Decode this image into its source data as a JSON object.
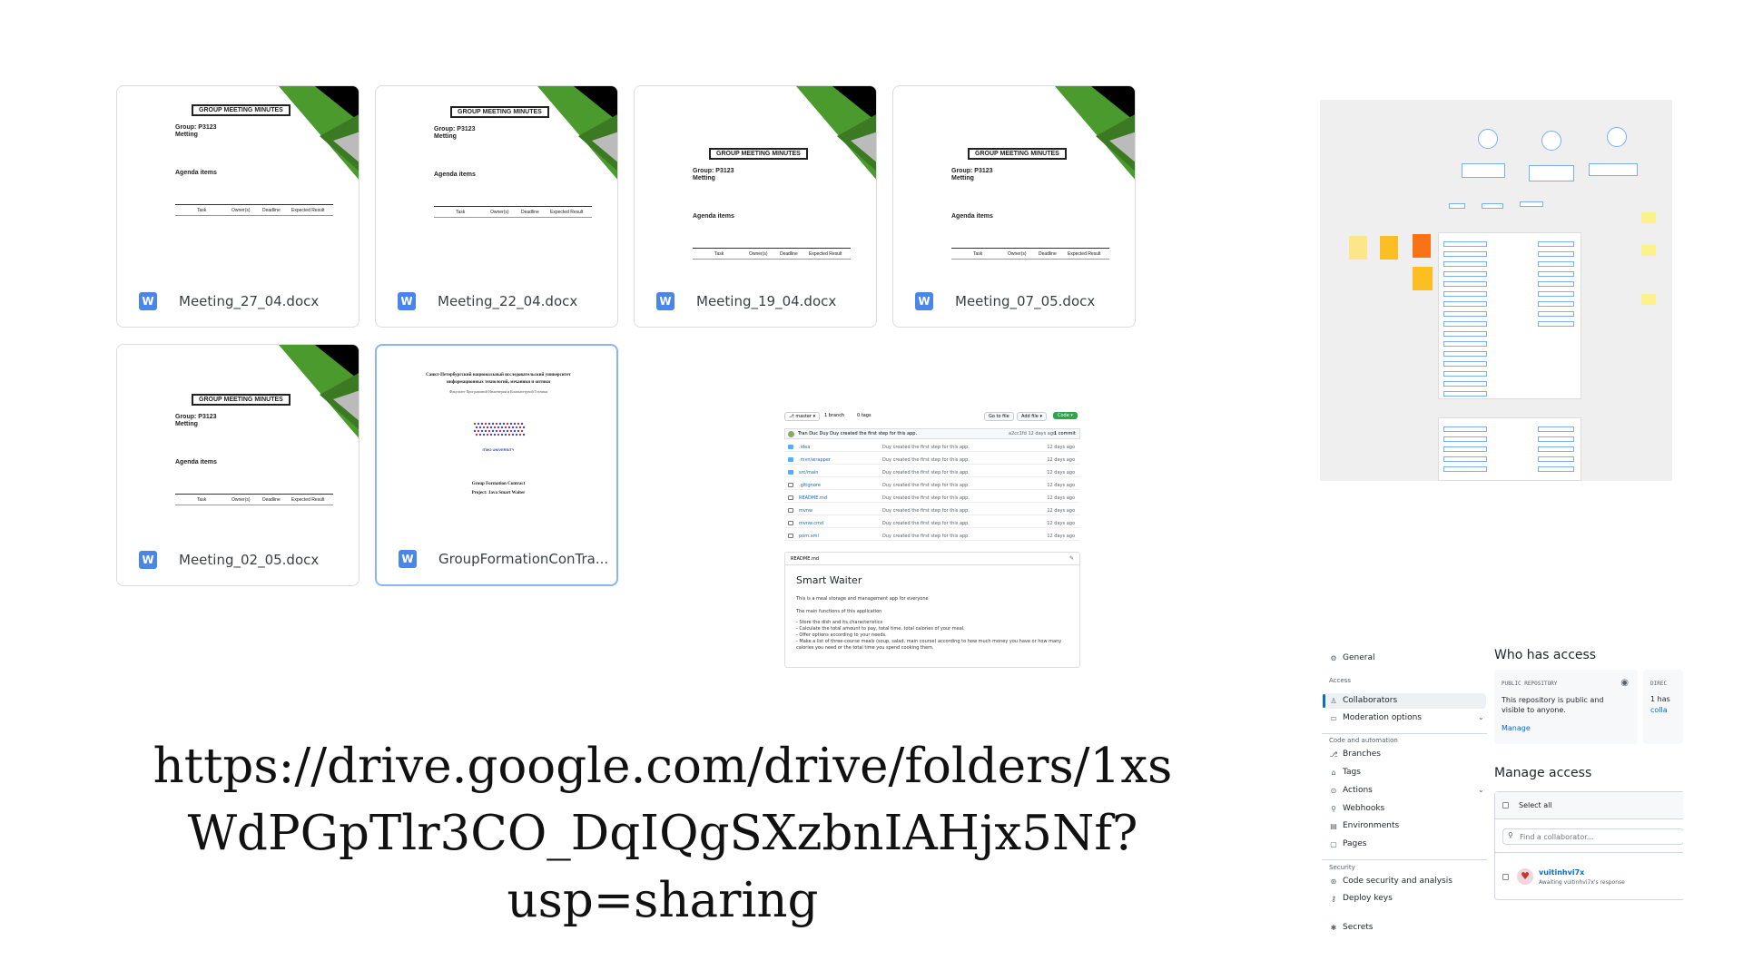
{
  "files": [
    {
      "name": "Meeting_27_04.docx",
      "icon": "W"
    },
    {
      "name": "Meeting_22_04.docx",
      "icon": "W"
    },
    {
      "name": "Meeting_19_04.docx",
      "icon": "W"
    },
    {
      "name": "Meeting_07_05.docx",
      "icon": "W"
    },
    {
      "name": "Meeting_02_05.docx",
      "icon": "W"
    },
    {
      "name": "GroupFormationConTra...",
      "icon": "W"
    }
  ],
  "doc_preview": {
    "title": "GROUP MEETING MINUTES",
    "group": "Group: P3123",
    "metting": "Metting",
    "agenda": "Agenda items",
    "col_task": "Task",
    "col_owner": "Owner(s)",
    "col_deadline": "Deadline",
    "col_result": "Expected Result"
  },
  "contract_preview": {
    "line1": "Санкт-Петербургский национальный исследовательский университет",
    "line2": "информационных технологий, механики и оптики",
    "line3": "Факультет Программной Инженерии и Компьютерной Техники",
    "logo": "ITMO UNIVERSITY",
    "line4": "Group Formation Contract",
    "line5": "Project: Java Smart Waiter"
  },
  "repo": {
    "branch": "master",
    "branches": "1 branch",
    "tags": "0 tags",
    "goto_file": "Go to file",
    "add_file": "Add file",
    "code": "Code",
    "commit_msg": "Tran Duc Duy Duy created the first step for this app.",
    "commit_meta": "a2cc1fd  12 days ago",
    "commits": "1 commit",
    "files": [
      {
        "name": ".idea",
        "dir": true
      },
      {
        "name": ".mvn/wrapper",
        "dir": true
      },
      {
        "name": "src/main",
        "dir": true
      },
      {
        "name": ".gitignore",
        "dir": false
      },
      {
        "name": "README.md",
        "dir": false
      },
      {
        "name": "mvnw",
        "dir": false
      },
      {
        "name": "mvnw.cmd",
        "dir": false
      },
      {
        "name": "pom.xml",
        "dir": false
      }
    ],
    "file_msg": "Duy created the first step for this app.",
    "file_age": "12 days ago",
    "readme_label": "README.md",
    "readme_title": "Smart Waiter",
    "readme_intro": "This is a meal storage and management app for everyone",
    "readme_main": "The main functions of this application",
    "readme_items": [
      "- Store the dish and its characteristics",
      "- Calculate the total amount to pay, total time, total calories of your meal.",
      "- Offer options according to your needs.",
      "- Make a list of three-course meals (soup, salad, main course) according to how much money you have or how many",
      "calories you need or the total time you spend cooking them."
    ]
  },
  "access": {
    "general": "General",
    "access_head": "Access",
    "collaborators": "Collaborators",
    "moderation": "Moderation options",
    "code_head": "Code and automation",
    "branches": "Branches",
    "tags": "Tags",
    "actions": "Actions",
    "webhooks": "Webhooks",
    "environments": "Environments",
    "pages": "Pages",
    "security_head": "Security",
    "code_security": "Code security and analysis",
    "deploy_keys": "Deploy keys",
    "secrets": "Secrets",
    "who_has_access": "Who has access",
    "public_repo": "PUBLIC REPOSITORY",
    "public_desc": "This repository is public and visible to anyone.",
    "manage": "Manage",
    "direct": "DIREC",
    "direct_has": "1 has",
    "direct_link": "colla",
    "manage_access": "Manage access",
    "select_all": "Select all",
    "find_placeholder": "Find a collaborator...",
    "collab_name": "vuitinhvi7x",
    "collab_status": "Awaiting vuitinhvi7x's response"
  },
  "link": {
    "line1": "https://drive.google.com/drive/folders/1xs",
    "line2": "WdPGpTlr3CO_DqIQgSXzbnIAHjx5Nf?",
    "line3": "usp=sharing"
  },
  "colors": {
    "word_blue": "#4a86e8",
    "doc_green": "#4a9a2e",
    "github_green": "#2da44e",
    "link_blue": "#0969da"
  }
}
